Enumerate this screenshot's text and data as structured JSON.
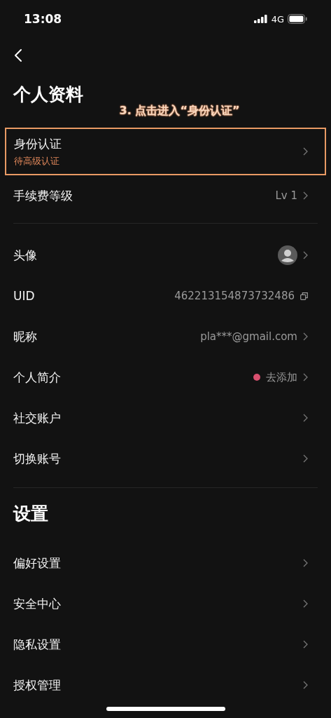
{
  "status_bar": {
    "time": "13:08",
    "network": "4G"
  },
  "profile": {
    "title": "个人资料",
    "annotation": "3. 点击进入“身份认证”",
    "groups": [
      [
        {
          "kind": "plain",
          "label": "身份认证",
          "sublabel": "待高级认证",
          "highlighted": true
        },
        {
          "kind": "plain",
          "label": "手续费等级",
          "value": "Lv 1",
          "highlighted": false
        }
      ],
      [
        {
          "kind": "avatar",
          "label": "头像",
          "highlighted": false
        },
        {
          "kind": "copy",
          "label": "UID",
          "value": "462213154873732486",
          "highlighted": false
        },
        {
          "kind": "plain",
          "label": "昵称",
          "value": "pla***@gmail.com",
          "highlighted": false
        },
        {
          "kind": "dot",
          "label": "个人简介",
          "value": "去添加",
          "color": "#d9506f",
          "highlighted": false
        },
        {
          "kind": "plain",
          "label": "社交账户",
          "highlighted": false
        },
        {
          "kind": "plain",
          "label": "切换账号",
          "highlighted": false
        }
      ]
    ]
  },
  "settings": {
    "title": "设置",
    "items": [
      {
        "label": "偏好设置",
        "highlighted": false
      },
      {
        "label": "安全中心",
        "highlighted": false
      },
      {
        "label": "隐私设置",
        "highlighted": false
      },
      {
        "label": "授权管理",
        "highlighted": false
      }
    ]
  }
}
